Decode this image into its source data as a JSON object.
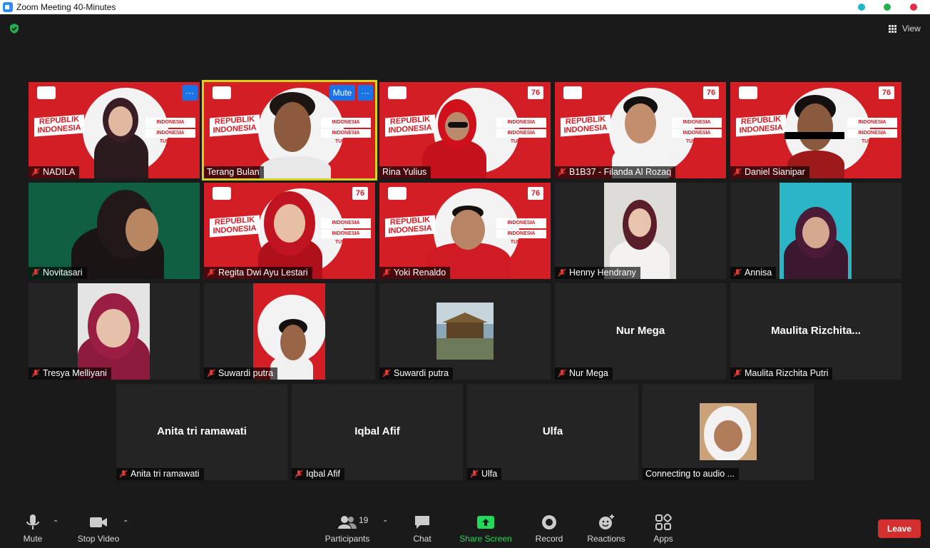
{
  "window": {
    "title": "Zoom Meeting 40-Minutes"
  },
  "header": {
    "view_label": "View"
  },
  "banner_text": {
    "rep": "REPUBLIK INDONESIA",
    "line1": "INDONESIA TANGGUH",
    "line2": "INDONESIA TUMBUH",
    "logo": "76"
  },
  "participants": [
    {
      "name": "NADILA",
      "mic_muted": true
    },
    {
      "name": "Terang Bulan",
      "mic_muted": false
    },
    {
      "name": "Rina Yulius",
      "mic_muted": false
    },
    {
      "name": "B1B37 - Filanda Al Rozaq",
      "mic_muted": true
    },
    {
      "name": "Daniel Sianipar",
      "mic_muted": true
    },
    {
      "name": "Novitasari",
      "mic_muted": true
    },
    {
      "name": "Regita Dwi Ayu Lestari",
      "mic_muted": true
    },
    {
      "name": "Yoki Renaldo",
      "mic_muted": true
    },
    {
      "name": "Henny Hendrany",
      "mic_muted": true
    },
    {
      "name": "Annisa",
      "mic_muted": true
    },
    {
      "name": "Tresya Melliyani",
      "mic_muted": true
    },
    {
      "name": "Suwardi putra",
      "mic_muted": true
    },
    {
      "name": "Suwardi putra",
      "mic_muted": true
    },
    {
      "name": "Nur Mega",
      "mic_muted": true,
      "center": "Nur Mega"
    },
    {
      "name": "Maulita Rizchita Putri",
      "mic_muted": true,
      "center": "Maulita  Rizchita..."
    },
    {
      "name": "Anita tri ramawati",
      "mic_muted": true,
      "center": "Anita tri ramawati"
    },
    {
      "name": "Iqbal Afif",
      "mic_muted": true,
      "center": "Iqbal Afif"
    },
    {
      "name": "Ulfa",
      "mic_muted": true,
      "center": "Ulfa"
    },
    {
      "name": "Connecting to audio ...",
      "mic_muted": false
    }
  ],
  "overlay": {
    "mute_label": "Mute",
    "more_label": "···"
  },
  "toolbar": {
    "mute": "Mute",
    "stop_video": "Stop Video",
    "participants": "Participants",
    "participants_count": "19",
    "chat": "Chat",
    "share_screen": "Share Screen",
    "record": "Record",
    "reactions": "Reactions",
    "apps": "Apps",
    "leave": "Leave"
  },
  "colors": {
    "accent": "#2d8cff",
    "share": "#23d959",
    "leave": "#d32f2f",
    "active_speaker": "#d6d11d",
    "banner_red": "#d41e26"
  }
}
